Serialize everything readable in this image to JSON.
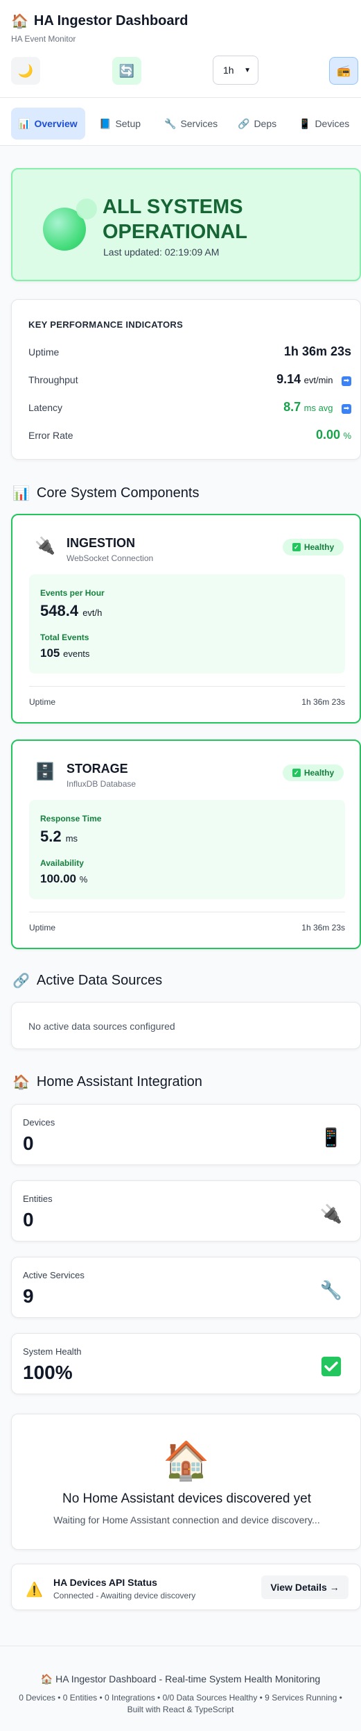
{
  "header": {
    "title": "HA Ingestor Dashboard",
    "subtitle": "HA Event Monitor",
    "time_range": "1h",
    "icons": {
      "theme": "moon-icon",
      "refresh": "refresh-icon",
      "alt": "radio-icon",
      "logo": "house-icon"
    }
  },
  "tabs": [
    {
      "label": "Overview",
      "icon": "chart-icon",
      "active": true
    },
    {
      "label": "Setup",
      "icon": "book-icon"
    },
    {
      "label": "Services",
      "icon": "wrench-icon"
    },
    {
      "label": "Deps",
      "icon": "link-icon"
    },
    {
      "label": "Devices",
      "icon": "device-icon"
    }
  ],
  "hero": {
    "status": "ALL SYSTEMS OPERATIONAL",
    "updated": "Last updated: 02:19:09 AM"
  },
  "kpi": {
    "title": "KEY PERFORMANCE INDICATORS",
    "uptime_label": "Uptime",
    "uptime_value": "1h 36m 23s",
    "throughput_label": "Throughput",
    "throughput_value": "9.14",
    "throughput_unit": "evt/min",
    "latency_label": "Latency",
    "latency_value": "8.7",
    "latency_unit": "ms avg",
    "error_label": "Error Rate",
    "error_value": "0.00",
    "error_unit": "%"
  },
  "core": {
    "title": "Core System Components",
    "ingestion": {
      "name": "INGESTION",
      "sub": "WebSocket Connection",
      "badge": "Healthy",
      "m1_label": "Events per Hour",
      "m1_value": "548.4",
      "m1_unit": "evt/h",
      "m2_label": "Total Events",
      "m2_value": "105",
      "m2_unit": "events",
      "uptime_label": "Uptime",
      "uptime_value": "1h 36m 23s"
    },
    "storage": {
      "name": "STORAGE",
      "sub": "InfluxDB Database",
      "badge": "Healthy",
      "m1_label": "Response Time",
      "m1_value": "5.2",
      "m1_unit": "ms",
      "m2_label": "Availability",
      "m2_value": "100.00",
      "m2_unit": "%",
      "uptime_label": "Uptime",
      "uptime_value": "1h 36m 23s"
    }
  },
  "sources": {
    "title": "Active Data Sources",
    "empty": "No active data sources configured"
  },
  "ha": {
    "title": "Home Assistant Integration",
    "stats": [
      {
        "label": "Devices",
        "value": "0",
        "icon": "phone-icon"
      },
      {
        "label": "Entities",
        "value": "0",
        "icon": "plug-icon"
      },
      {
        "label": "Active Services",
        "value": "9",
        "icon": "wrench-icon"
      },
      {
        "label": "System Health",
        "value": "100%",
        "icon": "check-icon"
      }
    ],
    "nodev_title": "No Home Assistant devices discovered yet",
    "nodev_sub": "Waiting for Home Assistant connection and device discovery...",
    "api_title": "HA Devices API Status",
    "api_sub": "Connected - Awaiting device discovery",
    "api_button": "View Details →"
  },
  "footer": {
    "title": "HA Ingestor Dashboard - Real-time System Health Monitoring",
    "stats": "0 Devices • 0 Entities • 0 Integrations • 0/0 Data Sources Healthy • 9 Services Running • Built with React & TypeScript"
  },
  "colors": {
    "accent": "#1d4ed8",
    "healthy": "#22c55e",
    "healthy_bg": "#dcfce7"
  }
}
